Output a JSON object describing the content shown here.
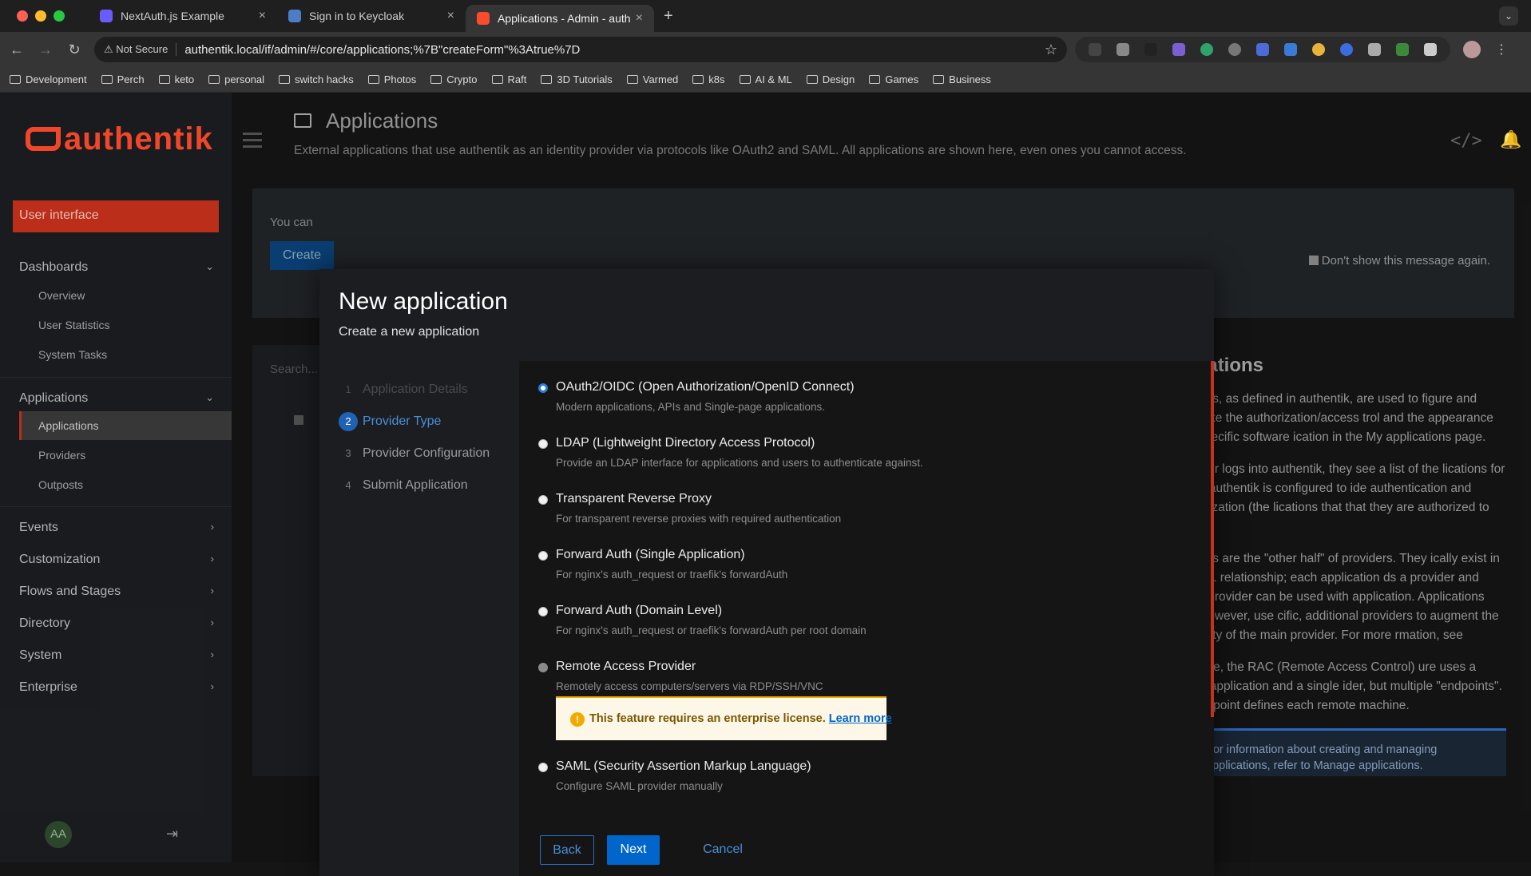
{
  "browser": {
    "tabs": [
      {
        "title": "NextAuth.js Example",
        "color": "#6a5cff"
      },
      {
        "title": "Sign in to Keycloak",
        "color": "#4d7cc8"
      },
      {
        "title": "Applications - Admin - authentik",
        "color": "#fd4b2d"
      }
    ],
    "not_secure": "Not Secure",
    "url": "authentik.local/if/admin/#/core/applications;%7B\"createForm\"%3Atrue%7D",
    "bookmarks": [
      "Development",
      "Perch",
      "keto",
      "personal",
      "switch hacks",
      "Photos",
      "Crypto",
      "Raft",
      "3D Tutorials",
      "Varmed",
      "k8s",
      "AI & ML",
      "Design",
      "Games",
      "Business"
    ]
  },
  "sidebar": {
    "logo": "authentik",
    "user_interface": "User interface",
    "dashboards": "Dashboards",
    "dashboards_items": [
      "Overview",
      "User Statistics",
      "System Tasks"
    ],
    "applications": "Applications",
    "applications_items": [
      "Applications",
      "Providers",
      "Outposts"
    ],
    "groups": [
      "Events",
      "Customization",
      "Flows and Stages",
      "Directory",
      "System",
      "Enterprise"
    ],
    "avatar": "AA"
  },
  "header": {
    "title": "Applications",
    "description": "External applications that use authentik as an identity provider via protocols like OAuth2 and SAML. All applications are shown here, even ones you cannot access."
  },
  "banner": {
    "text": "You can",
    "create": "Create",
    "dont_show": "Don't show this message again."
  },
  "table": {
    "search_placeholder": "Search..."
  },
  "help": {
    "title": "plications",
    "p1": "lications, as defined in authentik, are used to figure and separate the authorization/access trol and the appearance of a specific software ication in the My applications page.",
    "p2": "n a user logs into authentik, they see a list of the lications for which authentik is configured to ide authentication and authorization (the lications that that they are authorized to use).",
    "p3": "lications are the \"other half\" of providers. They ically exist in a 1-to-1 relationship; each application ds a provider and every provider can be used with application. Applications can, however, use cific, additional providers to augment the ctionality of the main provider. For more rmation, see",
    "p4": "hermore, the RAC (Remote Access Control) ure uses a single application and a single ider, but multiple \"endpoints\". An endpoint defines each remote machine.",
    "info": "For information about creating and managing applications, refer to Manage applications."
  },
  "modal": {
    "title": "New application",
    "subtitle": "Create a new application",
    "steps": [
      {
        "num": "1",
        "label": "Application Details"
      },
      {
        "num": "2",
        "label": "Provider Type"
      },
      {
        "num": "3",
        "label": "Provider Configuration"
      },
      {
        "num": "4",
        "label": "Submit Application"
      }
    ],
    "options": [
      {
        "label": "OAuth2/OIDC (Open Authorization/OpenID Connect)",
        "desc": "Modern applications, APIs and Single-page applications.",
        "checked": true
      },
      {
        "label": "LDAP (Lightweight Directory Access Protocol)",
        "desc": "Provide an LDAP interface for applications and users to authenticate against."
      },
      {
        "label": "Transparent Reverse Proxy",
        "desc": "For transparent reverse proxies with required authentication"
      },
      {
        "label": "Forward Auth (Single Application)",
        "desc": "For nginx's auth_request or traefik's forwardAuth"
      },
      {
        "label": "Forward Auth (Domain Level)",
        "desc": "For nginx's auth_request or traefik's forwardAuth per root domain"
      },
      {
        "label": "Remote Access Provider",
        "desc": "Remotely access computers/servers via RDP/SSH/VNC",
        "disabled": true
      },
      {
        "label": "SAML (Security Assertion Markup Language)",
        "desc": "Configure SAML provider manually"
      }
    ],
    "warning": "This feature requires an enterprise license.",
    "learn_more": "Learn more",
    "back": "Back",
    "next": "Next",
    "cancel": "Cancel"
  }
}
